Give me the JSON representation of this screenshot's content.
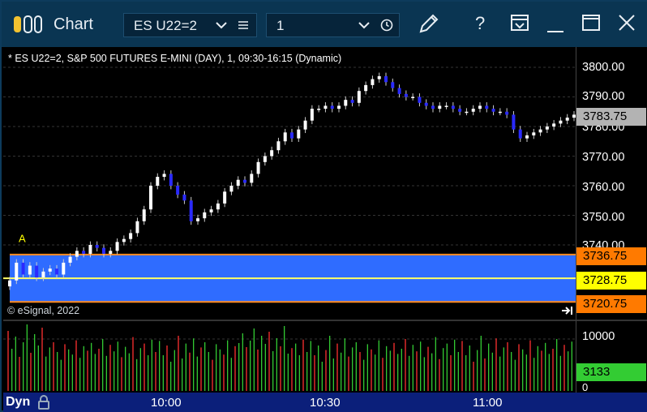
{
  "window": {
    "title": "Chart",
    "symbol": "ES U22=2",
    "interval": "1"
  },
  "chart": {
    "caption": "* ES U22=2, S&P 500 FUTURES E-MINI (DAY), 1, 09:30-16:15 (Dynamic)",
    "copyright": "© eSignal, 2022",
    "marker_label": "A",
    "price_ticks": [
      "3800.00",
      "3790.00",
      "3780.00",
      "3770.00",
      "3760.00",
      "3750.00",
      "3740.00"
    ],
    "last_price": "3783.75",
    "band_upper": "3736.75",
    "band_mid": "3728.75",
    "band_lower": "3720.75",
    "volume_tick": "10000",
    "volume_zero": "0",
    "volume_last": "3133",
    "time_labels": [
      "10:00",
      "10:30",
      "11:00"
    ],
    "mode_label": "Dyn",
    "colors": {
      "up": "#ffffff",
      "down": "#2a2aff",
      "band": "#2f6cff",
      "band_edge": "#ff8a1c",
      "mid_line": "#ffff66",
      "last_badge": "#b3b3b3",
      "upper_badge": "#ff7a00",
      "mid_badge": "#ffff00",
      "volume_badge": "#33cc33",
      "time_axis": "#0b1f7a"
    }
  },
  "chart_data": {
    "type": "candlestick",
    "title": "* ES U22=2, S&P 500 FUTURES E-MINI (DAY), 1, 09:30-16:15 (Dynamic)",
    "ylim": [
      3720,
      3804
    ],
    "x_labels": [
      "10:00",
      "10:30",
      "11:00"
    ],
    "series": [
      {
        "values": [
          3728,
          3734,
          3730,
          3733,
          3729,
          3731,
          3732,
          3730,
          3734,
          3736,
          3738,
          3737,
          3740,
          3739,
          3737,
          3738,
          3741,
          3742,
          3744,
          3748,
          3752,
          3760,
          3763,
          3764,
          3760,
          3757,
          3755,
          3748,
          3749,
          3751,
          3752,
          3754,
          3758,
          3760,
          3762,
          3761,
          3764,
          3768,
          3770,
          3772,
          3775,
          3778,
          3776,
          3779,
          3782,
          3786,
          3786,
          3787,
          3786,
          3787,
          3789,
          3788,
          3792,
          3794,
          3796,
          3797,
          3795,
          3793,
          3791,
          3790,
          3790,
          3788,
          3787,
          3786,
          3787,
          3787,
          3786,
          3785,
          3785,
          3786,
          3787,
          3786,
          3785,
          3785,
          3784,
          3779,
          3776,
          3777,
          3778,
          3779,
          3780,
          3781,
          3782,
          3783,
          3784
        ]
      },
      {
        "name": "Volume",
        "last": 3133,
        "max_tick": 10000
      }
    ],
    "bands": [
      3736.75,
      3728.75,
      3720.75
    ],
    "last_price": 3783.75
  }
}
